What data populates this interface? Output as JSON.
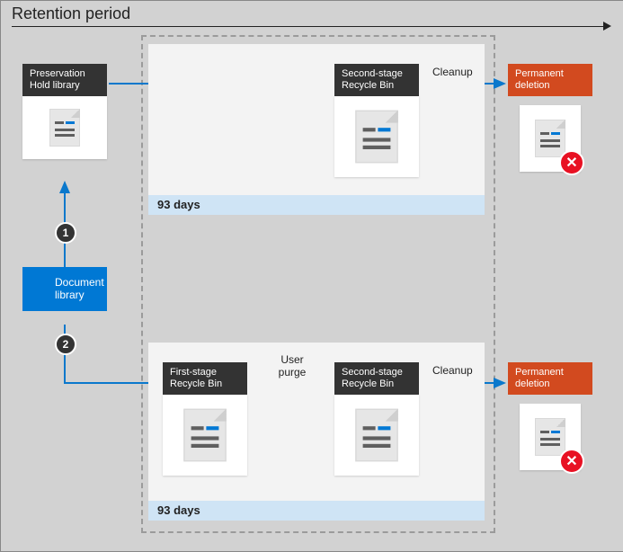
{
  "title": "Retention period",
  "steps": {
    "one": "1",
    "two": "2"
  },
  "boxes": {
    "preservation": "Preservation Hold library",
    "docLibrary": "Document library",
    "firstStage": "First-stage Recycle Bin",
    "secondStageTop": "Second-stage Recycle Bin",
    "secondStageBot": "Second-stage Recycle Bin",
    "permDelTop": "Permanent deletion",
    "permDelBot": "Permanent deletion"
  },
  "labels": {
    "userPurge": "User purge",
    "cleanupTop": "Cleanup",
    "cleanupBot": "Cleanup",
    "daysTop": "93 days",
    "daysBot": "93 days"
  }
}
